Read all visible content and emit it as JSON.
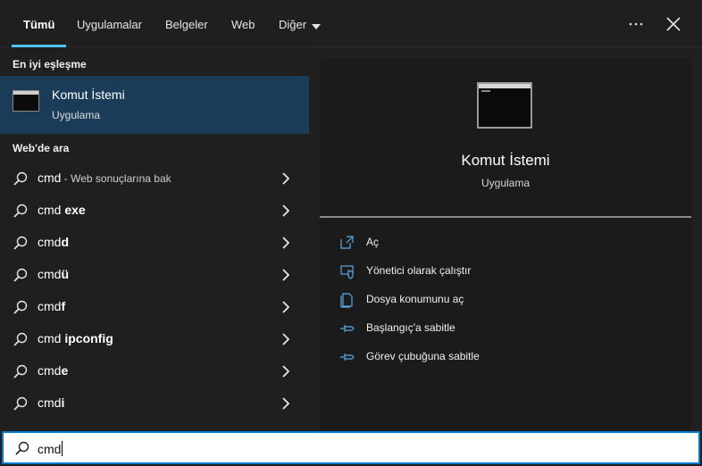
{
  "tabs": [
    {
      "label": "Tümü",
      "active": true
    },
    {
      "label": "Uygulamalar"
    },
    {
      "label": "Belgeler"
    },
    {
      "label": "Web"
    },
    {
      "label": "Diğer"
    }
  ],
  "topbar_icons": [
    "more-icon",
    "close-icon"
  ],
  "best_match": {
    "section_title": "En iyi eşleşme",
    "name": "Komut İstemi",
    "type": "Uygulama"
  },
  "web": {
    "section_title": "Web'de ara",
    "items": [
      {
        "prefix": "cmd",
        "bold": "",
        "note": " - Web sonuçlarına bak"
      },
      {
        "prefix": "cmd ",
        "bold": "exe",
        "note": ""
      },
      {
        "prefix": "cmd",
        "bold": "d",
        "note": ""
      },
      {
        "prefix": "cmd",
        "bold": "ü",
        "note": ""
      },
      {
        "prefix": "cmd",
        "bold": "f",
        "note": ""
      },
      {
        "prefix": "cmd ",
        "bold": "ipconfig",
        "note": ""
      },
      {
        "prefix": "cmd",
        "bold": "e",
        "note": ""
      },
      {
        "prefix": "cmd",
        "bold": "i",
        "note": ""
      }
    ]
  },
  "preview": {
    "name": "Komut İstemi",
    "type": "Uygulama",
    "actions": [
      {
        "label": "Aç",
        "icon": "open-icon"
      },
      {
        "label": "Yönetici olarak çalıştır",
        "icon": "shield-icon"
      },
      {
        "label": "Dosya konumunu aç",
        "icon": "file-location-icon"
      },
      {
        "label": "Başlangıç'a sabitle",
        "icon": "pin-icon"
      },
      {
        "label": "Görev çubuğuna sabitle",
        "icon": "pin-icon"
      }
    ]
  },
  "search": {
    "value": "cmd"
  },
  "colors": {
    "accent": "#4cc2ff",
    "selection": "#1a3c59",
    "search_border": "#0078d4"
  }
}
